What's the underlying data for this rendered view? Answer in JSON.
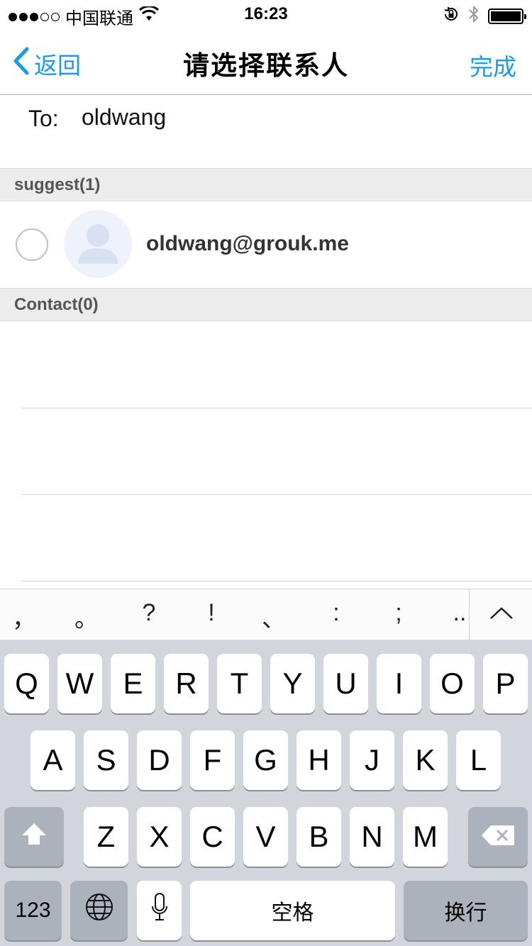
{
  "status_bar": {
    "carrier": "中国联通",
    "time": "16:23",
    "signal_dots_filled": 3,
    "signal_dots_total": 5,
    "icons": [
      "wifi-icon",
      "rotation-lock-icon",
      "bluetooth-icon",
      "battery-icon"
    ]
  },
  "nav": {
    "back_label": "返回",
    "title": "请选择联系人",
    "done_label": "完成",
    "accent_color": "#1a9be8"
  },
  "to_field": {
    "label": "To:",
    "value": "oldwang"
  },
  "sections": {
    "suggest_header": "suggest(1)",
    "contact_header": "Contact(0)"
  },
  "suggest_items": [
    {
      "email": "oldwang@grouk.me",
      "selected": false,
      "avatar_icon": "person-avatar-icon"
    }
  ],
  "candidate_bar": {
    "items": [
      "，",
      "。",
      "?",
      "!",
      "、",
      ":",
      ";",
      ".."
    ],
    "collapse_icon": "chevron-up-icon"
  },
  "keyboard": {
    "row1": [
      "Q",
      "W",
      "E",
      "R",
      "T",
      "Y",
      "U",
      "I",
      "O",
      "P"
    ],
    "row2": [
      "A",
      "S",
      "D",
      "F",
      "G",
      "H",
      "J",
      "K",
      "L"
    ],
    "row3": [
      "Z",
      "X",
      "C",
      "V",
      "B",
      "N",
      "M"
    ],
    "numbers_label": "123",
    "space_label": "空格",
    "return_label": "换行",
    "shift_icon": "shift-icon",
    "delete_icon": "backspace-icon",
    "globe_icon": "globe-icon",
    "mic_icon": "microphone-icon"
  }
}
